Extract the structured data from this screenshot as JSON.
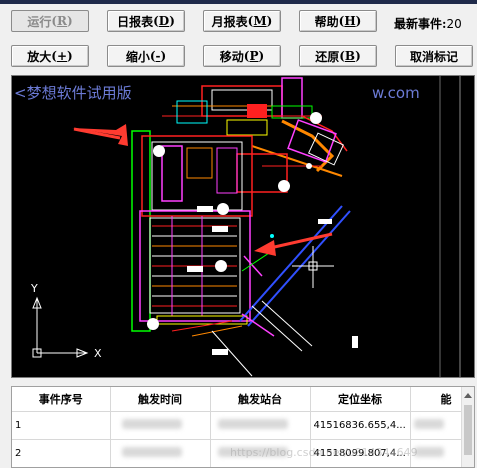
{
  "toolbar": {
    "run": "运行",
    "run_key": "R",
    "daily": "日报表",
    "daily_key": "D",
    "monthly": "月报表",
    "monthly_key": "M",
    "help": "帮助",
    "help_key": "H",
    "zoom_in": "放大",
    "zoom_in_key": "+",
    "zoom_out": "缩小",
    "zoom_out_key": "-",
    "move": "移动",
    "move_key": "P",
    "restore": "还原",
    "restore_key": "B",
    "clear_marks": "取消标记"
  },
  "latest_event": {
    "label": "最新事件:",
    "value": "20"
  },
  "canvas": {
    "overlay_text": "<梦想软件试用版",
    "overlay_url": "w.com",
    "axis_y": "Y",
    "axis_x": "X"
  },
  "table": {
    "headers": [
      "事件序号",
      "触发时间",
      "触发站台",
      "定位坐标",
      "能"
    ],
    "rows": [
      {
        "index": "1",
        "coord": "41516836.655,4..."
      },
      {
        "index": "2",
        "coord": "41518099.807,4..."
      }
    ]
  },
  "watermark": "https://blog.csdn.net/u014344649",
  "colors": {
    "canvas_bg": "#000000",
    "arrow": "#ff3b30"
  }
}
